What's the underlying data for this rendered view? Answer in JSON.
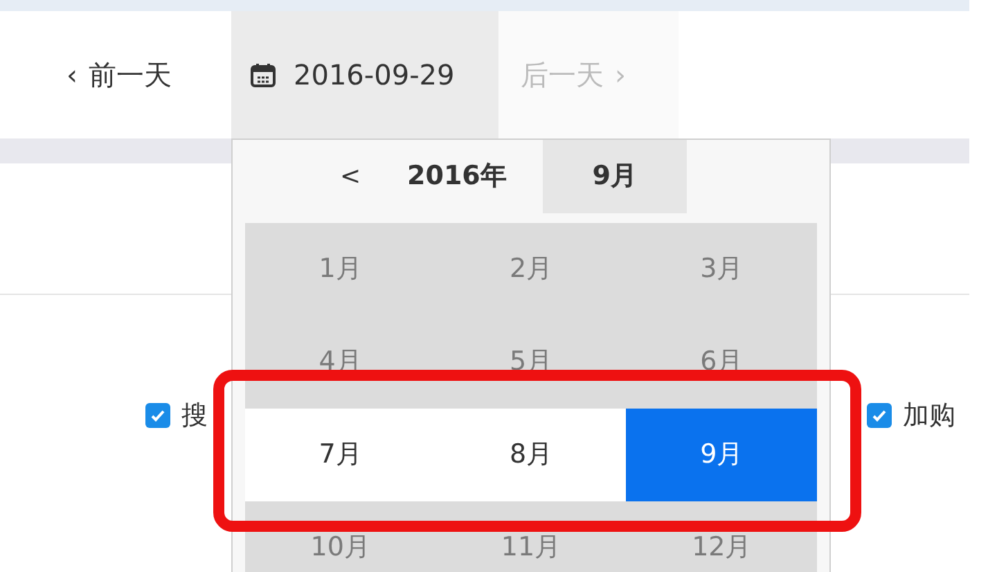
{
  "date_nav": {
    "prev": {
      "icon": "‹",
      "label": "前一天"
    },
    "current": "2016-09-29",
    "next": {
      "label": "后一天",
      "icon": "›",
      "disabled": true
    }
  },
  "filters": [
    {
      "label": "搜",
      "checked": true
    },
    {
      "label": "加购",
      "checked": true
    }
  ],
  "picker": {
    "prev": "<",
    "year": "2016年",
    "month": "9月",
    "months": [
      {
        "label": "1月",
        "disabled": true,
        "selected": false
      },
      {
        "label": "2月",
        "disabled": true,
        "selected": false
      },
      {
        "label": "3月",
        "disabled": true,
        "selected": false
      },
      {
        "label": "4月",
        "disabled": true,
        "selected": false
      },
      {
        "label": "5月",
        "disabled": true,
        "selected": false
      },
      {
        "label": "6月",
        "disabled": true,
        "selected": false
      },
      {
        "label": "7月",
        "disabled": false,
        "selected": false
      },
      {
        "label": "8月",
        "disabled": false,
        "selected": false
      },
      {
        "label": "9月",
        "disabled": false,
        "selected": true
      },
      {
        "label": "10月",
        "disabled": true,
        "selected": false
      },
      {
        "label": "11月",
        "disabled": true,
        "selected": false
      },
      {
        "label": "12月",
        "disabled": true,
        "selected": false
      }
    ]
  }
}
